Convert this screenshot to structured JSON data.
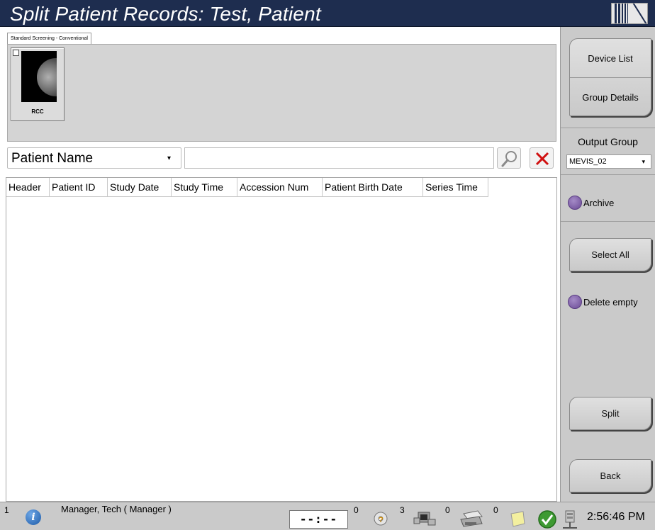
{
  "window": {
    "title": "Split Patient Records: Test, Patient"
  },
  "thumbnails": {
    "tab_label": "Standard Screening - Conventional",
    "items": [
      {
        "label": "RCC",
        "checked": false
      }
    ]
  },
  "search": {
    "field_selected": "Patient Name",
    "query": "",
    "search_icon": "magnifier-icon",
    "clear_icon": "red-x-icon"
  },
  "table": {
    "columns": [
      "Header",
      "Patient ID",
      "Study Date",
      "Study Time",
      "Accession Num",
      "Patient Birth Date",
      "Series Time"
    ],
    "rows": []
  },
  "sidebar": {
    "device_list": "Device List",
    "group_details": "Group Details",
    "output_group_label": "Output Group",
    "output_group_value": "MEVIS_02",
    "archive_label": "Archive",
    "select_all": "Select All",
    "delete_empty_label": "Delete empty",
    "split": "Split",
    "back": "Back"
  },
  "status_bar": {
    "screen_number": "1",
    "user": "Manager, Tech ( Manager )",
    "timer": "--:--",
    "counts": {
      "queue": "0",
      "help": "3",
      "devices": "0",
      "printer": "0"
    },
    "time": "2:56:46 PM"
  },
  "colors": {
    "title_bar": "#1e2d4f",
    "panel_gray": "#cacaca",
    "radio_purple": "#7a5aa6",
    "clear_red": "#d01010"
  }
}
